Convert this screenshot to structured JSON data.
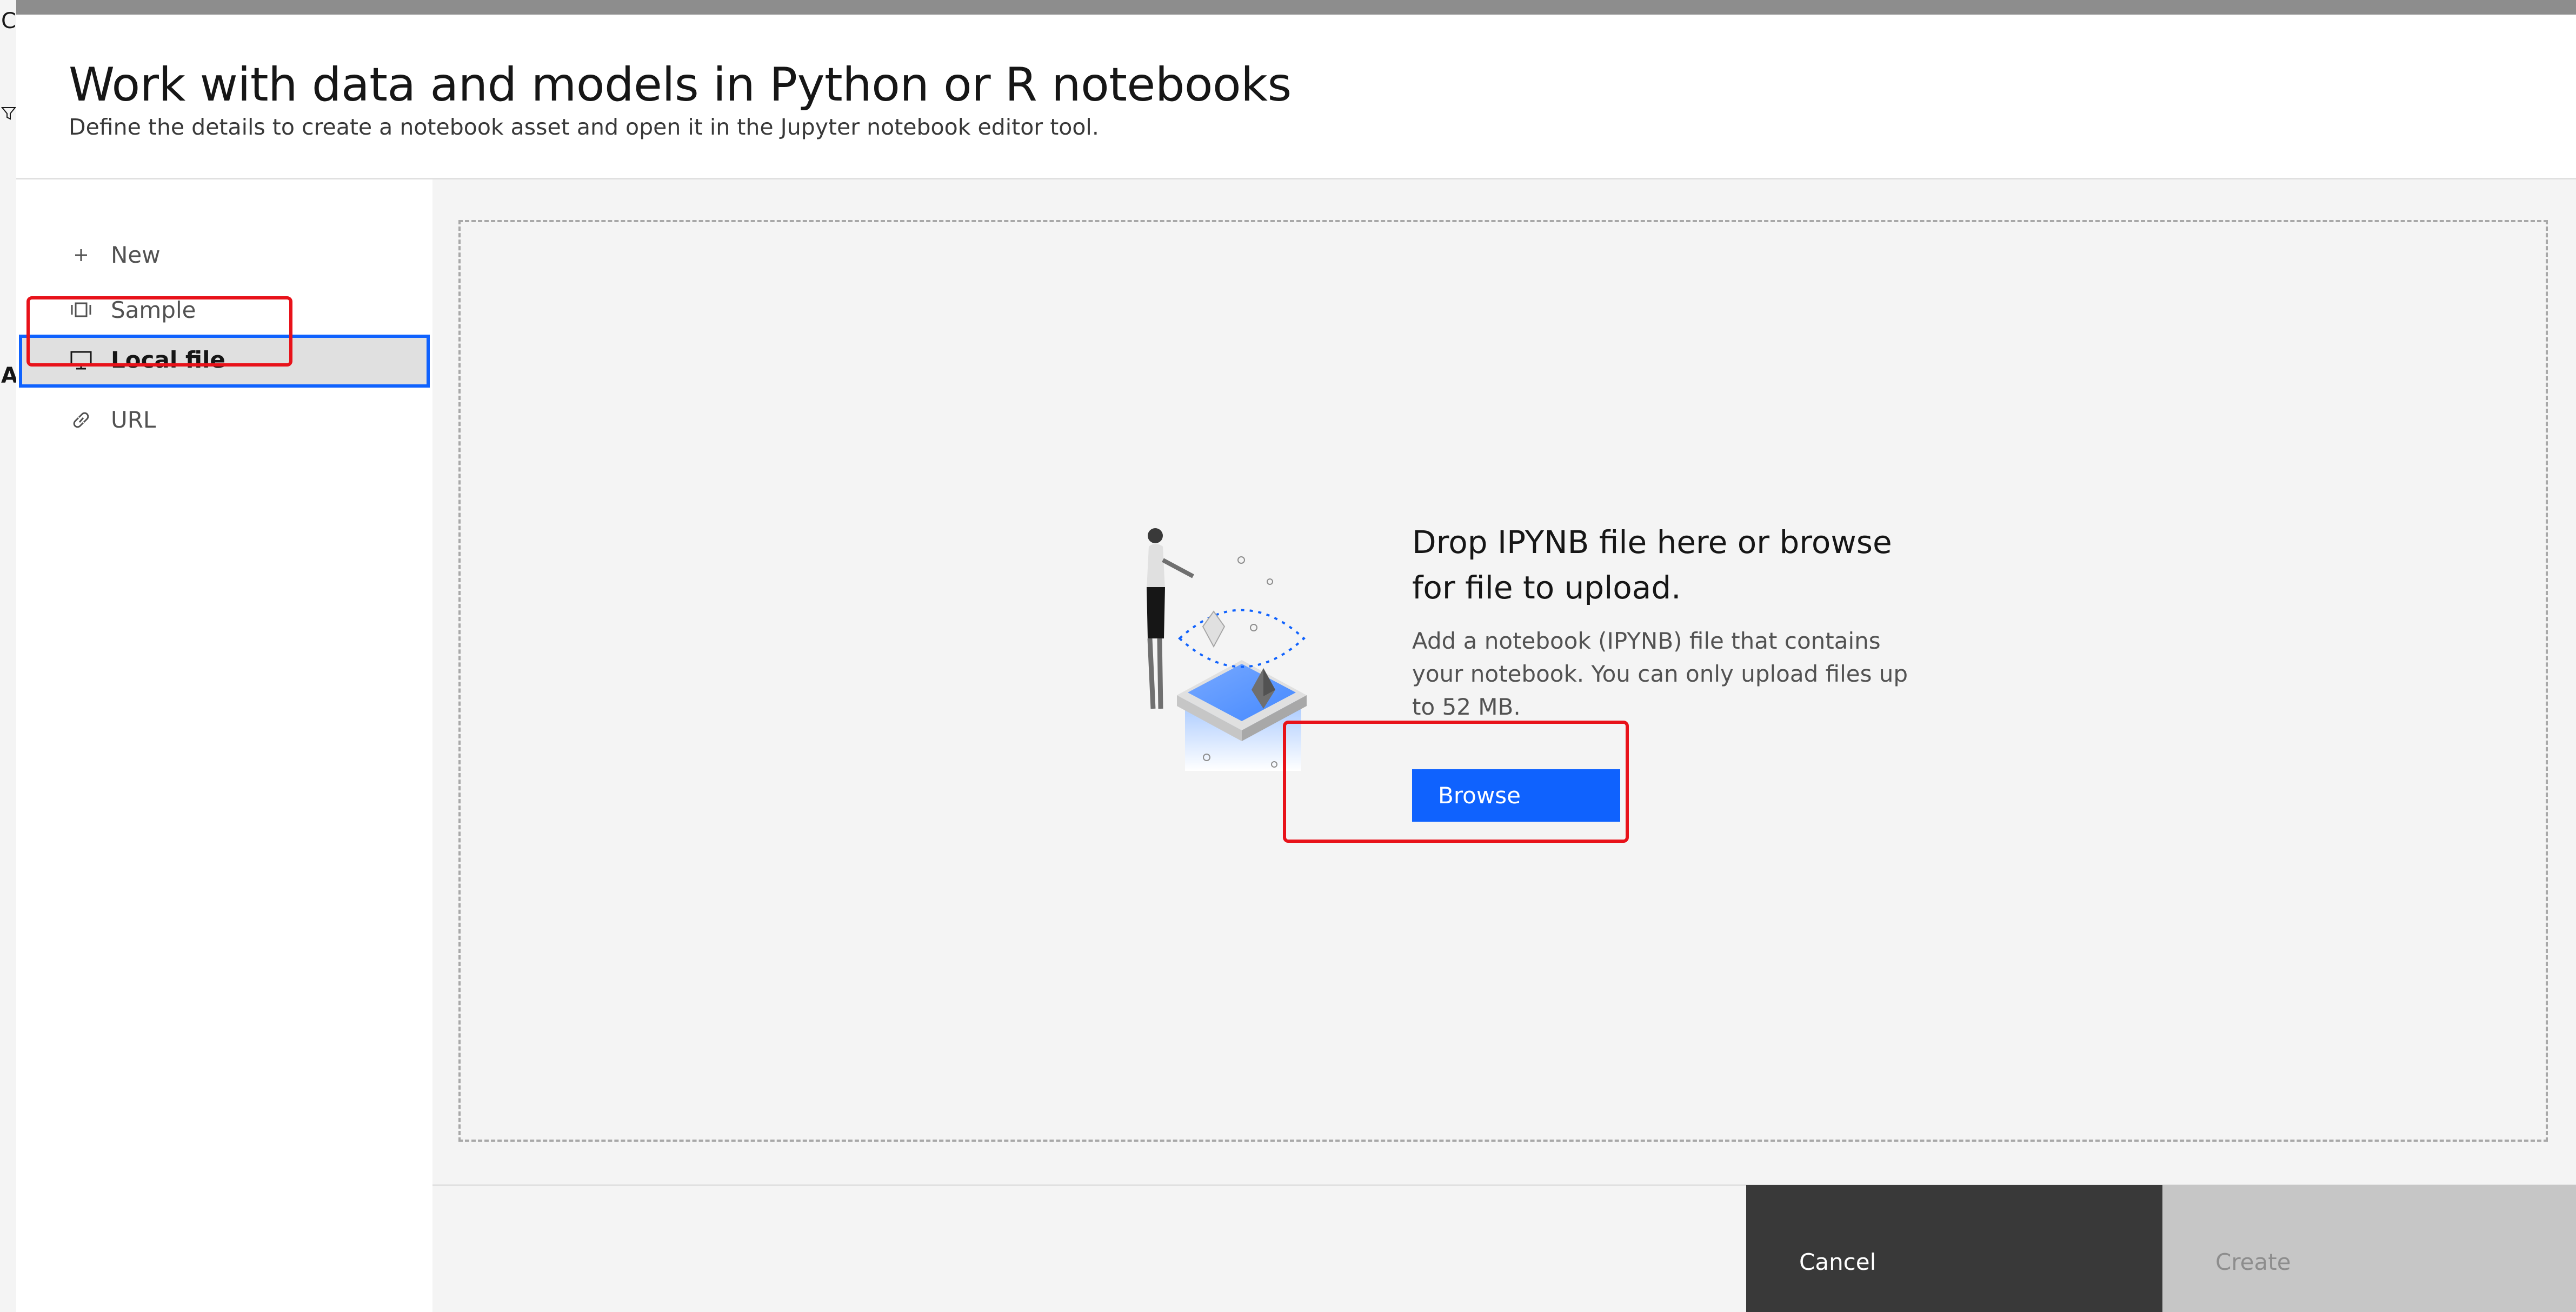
{
  "dialog": {
    "title": "Work with data and models in Python or R notebooks",
    "subtitle": "Define the details to create a notebook asset and open it in the Jupyter notebook editor tool."
  },
  "sidebar": {
    "items": [
      {
        "label": "New",
        "icon": "plus-icon",
        "selected": false
      },
      {
        "label": "Sample",
        "icon": "sample-icon",
        "selected": false
      },
      {
        "label": "Local file",
        "icon": "monitor-icon",
        "selected": true
      },
      {
        "label": "URL",
        "icon": "link-icon",
        "selected": false
      }
    ]
  },
  "dropzone": {
    "heading_line1": "Drop IPYNB file here or browse",
    "heading_line2": "for file to upload.",
    "desc_line1": "Add a notebook (IPYNB) file that contains",
    "desc_line2": "your notebook. You can only upload files up",
    "desc_line3": "to 52 MB.",
    "browse_label": "Browse"
  },
  "footer": {
    "cancel_label": "Cancel",
    "create_label": "Create"
  },
  "background_fragments": {
    "top": "C",
    "mid": "As"
  },
  "colors": {
    "primary": "#0f62fe",
    "annotation": "#e8121a",
    "secondary_button": "#393939",
    "disabled_button": "#c6c6c6"
  }
}
